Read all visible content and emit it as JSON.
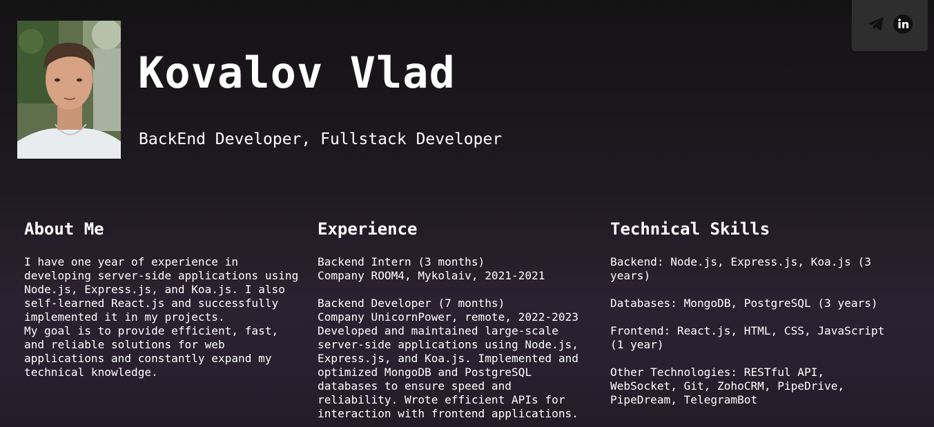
{
  "header": {
    "name": "Kovalov Vlad",
    "role": "BackEnd Developer, Fullstack Developer",
    "photo_icon": "profile-photo"
  },
  "social": {
    "links": [
      {
        "name": "telegram",
        "icon": "telegram-icon"
      },
      {
        "name": "linkedin",
        "icon": "linkedin-icon"
      }
    ]
  },
  "sections": {
    "about": {
      "title": "About Me",
      "lines": [
        "I have one year of experience in",
        "developing server-side applications using",
        "Node.js, Express.js, and Koa.js. I also",
        "self-learned React.js and successfully",
        "implemented it in my projects.",
        "My goal is to provide efficient, fast,",
        "and reliable solutions for web",
        "applications and constantly expand my",
        "technical knowledge."
      ]
    },
    "experience": {
      "title": "Experience",
      "jobs": [
        {
          "lines": [
            "Backend Intern (3 months)",
            "Company ROOM4, Mykolaiv, 2021-2021"
          ]
        },
        {
          "lines": [
            "Backend Developer (7 months)",
            "Company UnicornPower, remote, 2022-2023",
            "Developed and maintained large-scale",
            "server-side applications using Node.js,",
            "Express.js, and Koa.js. Implemented and",
            "optimized MongoDB and PostgreSQL",
            "databases to ensure speed and",
            "reliability. Wrote efficient APIs for",
            "interaction with frontend applications."
          ]
        }
      ]
    },
    "skills": {
      "title": "Technical Skills",
      "groups": [
        {
          "lines": [
            "Backend: Node.js, Express.js, Koa.js (3",
            "years)"
          ]
        },
        {
          "lines": [
            "Databases: MongoDB, PostgreSQL (3 years)"
          ]
        },
        {
          "lines": [
            "Frontend: React.js, HTML, CSS, JavaScript",
            "(1 year)"
          ]
        },
        {
          "lines": [
            "Other Technologies: RESTful API,",
            "WebSocket, Git, ZohoCRM, PipeDrive,",
            "PipeDream, TelegramBot"
          ]
        }
      ]
    }
  },
  "colors": {
    "text": "#ffffff",
    "social_bg": "#2e2e2e",
    "icon": "#111111"
  }
}
